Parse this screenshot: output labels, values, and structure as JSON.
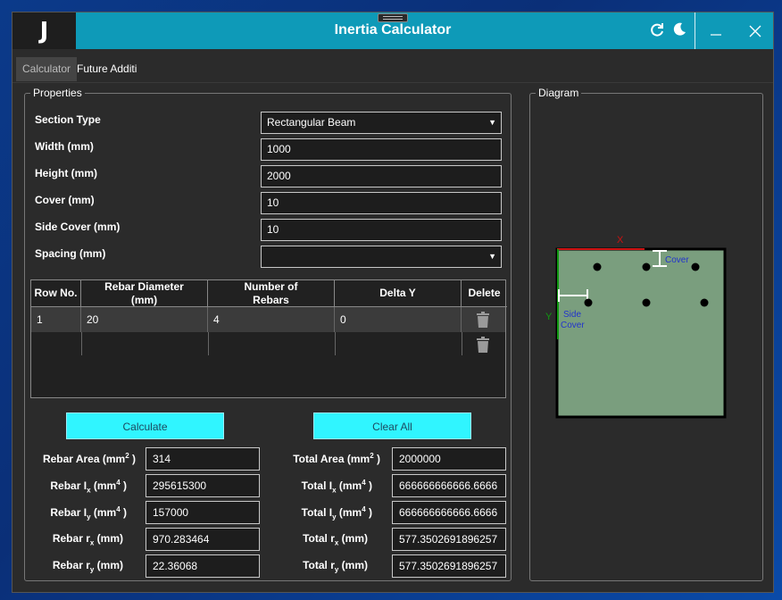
{
  "window": {
    "title": "Inertia Calculator",
    "logo": "J"
  },
  "tabs": [
    {
      "label": "Calculator"
    },
    {
      "label": "Future Additi"
    }
  ],
  "properties": {
    "group_label": "Properties",
    "section_type": {
      "label": "Section Type",
      "value": "Rectangular Beam"
    },
    "width": {
      "label": "Width (mm)",
      "value": "1000"
    },
    "height": {
      "label": "Height (mm)",
      "value": "2000"
    },
    "cover": {
      "label": "Cover (mm)",
      "value": "10"
    },
    "side_cover": {
      "label": "Side Cover (mm)",
      "value": "10"
    },
    "spacing": {
      "label": "Spacing (mm)",
      "value": ""
    }
  },
  "rebar_table": {
    "headers": [
      "Row No.",
      "Rebar Diameter (mm)",
      "Number of Rebars",
      "Delta Y",
      "Delete"
    ],
    "rows": [
      {
        "row": "1",
        "diameter": "20",
        "count": "4",
        "delta_y": "0"
      }
    ]
  },
  "buttons": {
    "calculate": "Calculate",
    "clear_all": "Clear All"
  },
  "results": {
    "rebar_area": {
      "label": "Rebar Area (mm",
      "sup": "2",
      "suffix": " )",
      "value": "314"
    },
    "rebar_ix": {
      "label": "Rebar I",
      "sub": "x",
      "mid": " (mm",
      "sup": "4",
      "suffix": " )",
      "value": "295615300"
    },
    "rebar_iy": {
      "label": "Rebar I",
      "sub": "y",
      "mid": " (mm",
      "sup": "4",
      "suffix": " )",
      "value": "157000"
    },
    "rebar_rx": {
      "label": "Rebar r",
      "sub": "x",
      "suffix": " (mm)",
      "value": "970.283464"
    },
    "rebar_ry": {
      "label": "Rebar r",
      "sub": "y",
      "suffix": " (mm)",
      "value": "22.36068"
    },
    "total_area": {
      "label": "Total Area (mm",
      "sup": "2",
      "suffix": " )",
      "value": "2000000"
    },
    "total_ix": {
      "label": "Total I",
      "sub": "x",
      "mid": " (mm",
      "sup": "4",
      "suffix": " )",
      "value": "666666666666.6666"
    },
    "total_iy": {
      "label": "Total I",
      "sub": "y",
      "mid": " (mm",
      "sup": "4",
      "suffix": " )",
      "value": "666666666666.6666"
    },
    "total_rx": {
      "label": "Total r",
      "sub": "x",
      "suffix": " (mm)",
      "value": "577.3502691896257"
    },
    "total_ry": {
      "label": "Total r",
      "sub": "y",
      "suffix": " (mm)",
      "value": "577.3502691896257"
    }
  },
  "diagram": {
    "group_label": "Diagram",
    "x_label": "X",
    "y_label": "Y",
    "cover_label": "Cover",
    "side_cover_label_1": "Side",
    "side_cover_label_2": "Cover",
    "section_color": "#7a9e7e",
    "x_axis_color": "#cc1111",
    "y_axis_color": "#119911",
    "annotation_color": "#2233cc"
  },
  "icons": {
    "refresh": "refresh-icon",
    "theme": "moon-icon",
    "minimize": "minimize-icon",
    "close": "close-icon",
    "trash": "trash-icon",
    "dropdown": "chevron-down-icon"
  }
}
